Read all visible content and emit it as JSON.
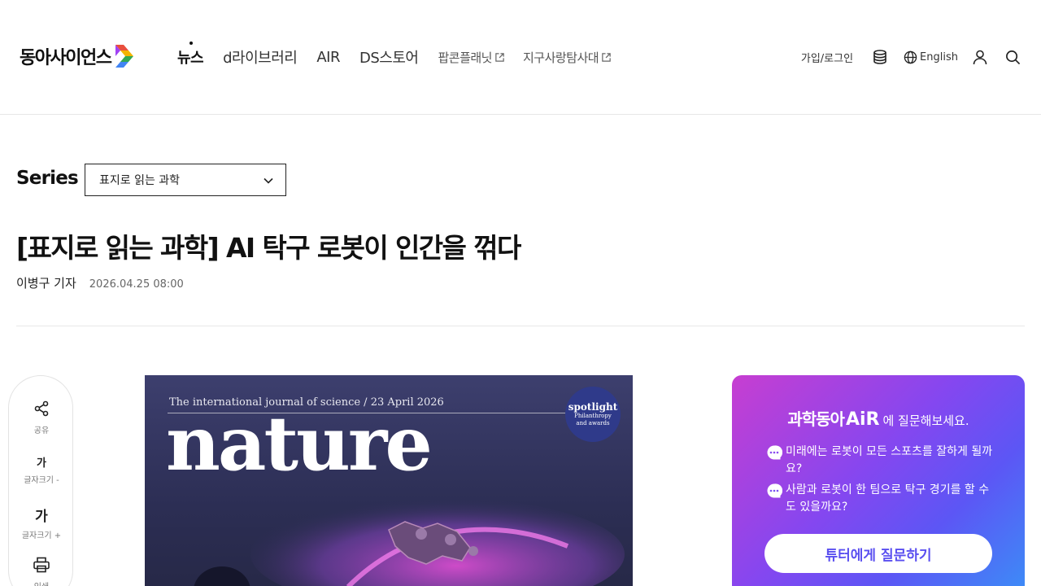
{
  "header": {
    "logo_text": "동아사이언스",
    "nav": [
      {
        "label": "뉴스",
        "active": true
      },
      {
        "label": "d라이브러리"
      },
      {
        "label": "AIR"
      },
      {
        "label": "DS스토어"
      },
      {
        "label": "팝콘플래닛",
        "external": true
      },
      {
        "label": "지구사랑탐사대",
        "external": true
      }
    ],
    "login_label": "가입/로그인",
    "language_label": "English",
    "icons": [
      "database-icon",
      "globe-icon",
      "user-icon",
      "search-icon"
    ]
  },
  "series": {
    "label": "Series",
    "selected": "표지로 읽는 과학"
  },
  "article": {
    "title": "[표지로 읽는 과학] AI 탁구 로봇이 인간을 꺾다",
    "author": "이병구 기자",
    "date": "2026.04.25 08:00"
  },
  "toolbar": {
    "share_label": "공유",
    "font_smaller_glyph": "가",
    "font_smaller_label": "글자크기 -",
    "font_bigger_glyph": "가",
    "font_bigger_label": "글자크기 +",
    "print_label": "인쇄"
  },
  "cover": {
    "tagline": "The international journal of science / 23 April 2026",
    "masthead": "nature",
    "badge_title": "spotlight",
    "badge_sub1": "Philanthropy",
    "badge_sub2": "and awards"
  },
  "ai_panel": {
    "brand": "과학동아",
    "brand_air": "AiR",
    "heading_suffix": "에 질문해보세요.",
    "questions": [
      "미래에는 로봇이 모든 스포츠를 잘하게 될까요?",
      "사람과 로봇이 한 팀으로 탁구 경기를 할 수도 있을까요?"
    ],
    "button_label": "튜터에게 질문하기"
  },
  "colors": {
    "ai_gradient_start": "#c73ed1",
    "ai_gradient_end": "#3c8df7",
    "cover_bg": "#2c2e54",
    "ai_button_text": "#5a4ff0"
  }
}
